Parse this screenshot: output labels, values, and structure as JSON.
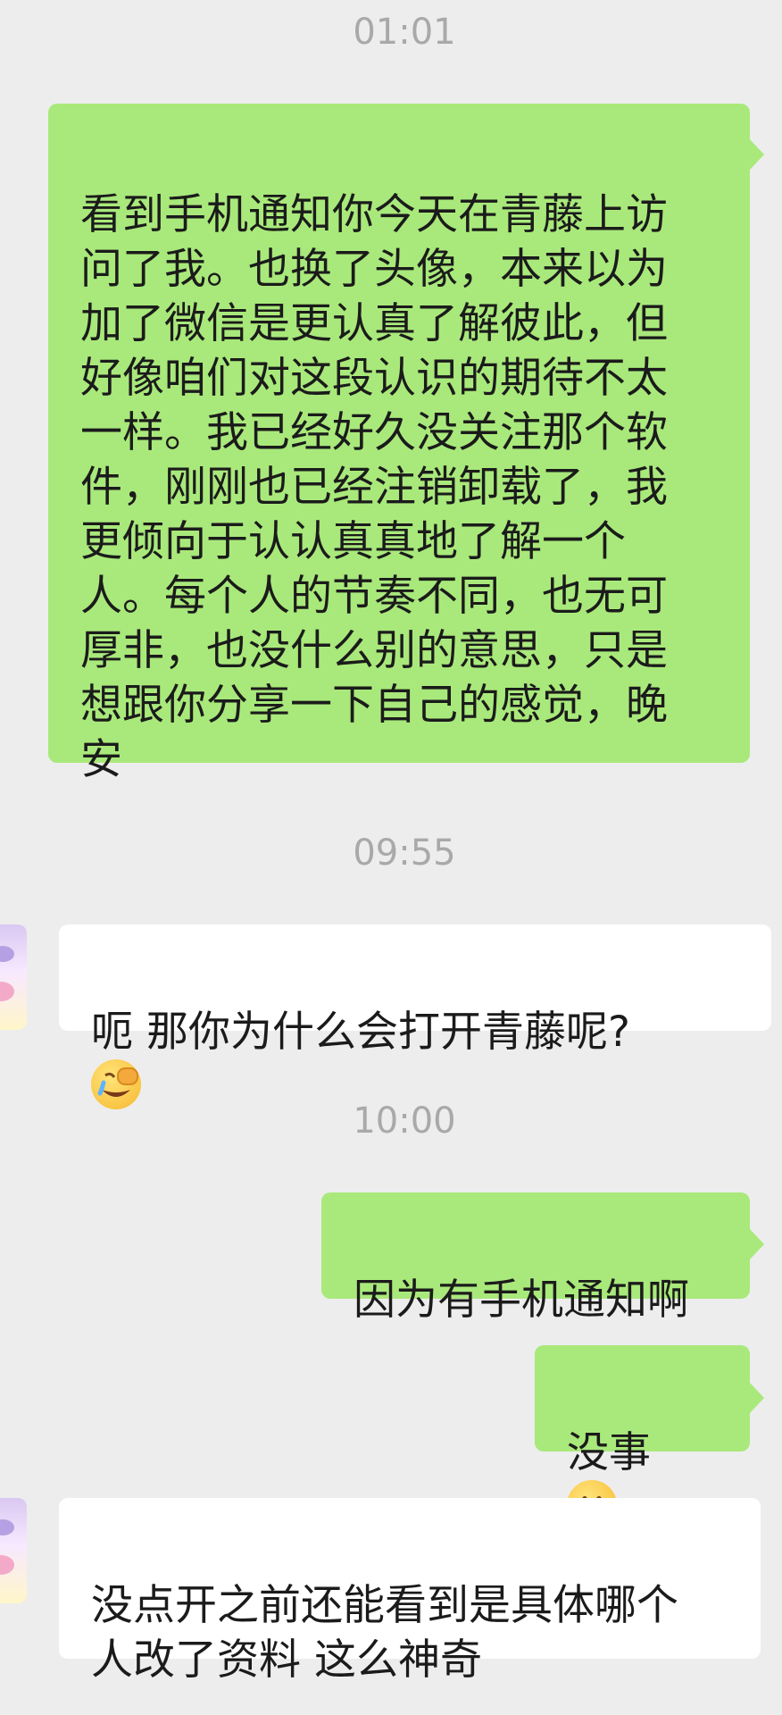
{
  "chat": {
    "messages": [
      {
        "type": "time",
        "text": "01:01"
      },
      {
        "type": "message",
        "side": "me",
        "text": "看到手机通知你今天在青藤上访\n问了我。也换了头像，本来以为\n加了微信是更认真了解彼此，但\n好像咱们对这段认识的期待不太\n一样。我已经好久没关注那个软\n件，刚刚也已经注销卸载了，我\n更倾向于认认真真地了解一个\n人。每个人的节奏不同，也无可\n厚非，也没什么别的意思，只是\n想跟你分享一下自己的感觉，晚\n安"
      },
      {
        "type": "time",
        "text": "09:55"
      },
      {
        "type": "message",
        "side": "them",
        "text": "呃 那你为什么会打开青藤呢?",
        "emoji": "face-palm-laugh-emoji"
      },
      {
        "type": "time",
        "text": "10:00"
      },
      {
        "type": "message",
        "side": "me",
        "text": "因为有手机通知啊"
      },
      {
        "type": "message",
        "side": "me",
        "text": "没事",
        "emoji": "slight-smile-emoji"
      },
      {
        "type": "message",
        "side": "them",
        "text": "没点开之前还能看到是具体哪个\n人改了资料 这么神奇"
      }
    ]
  },
  "colors": {
    "background": "#ededed",
    "my_bubble": "#a9e97b",
    "their_bubble": "#ffffff",
    "timestamp": "#a9a9a9",
    "text": "#1b1b1b"
  }
}
